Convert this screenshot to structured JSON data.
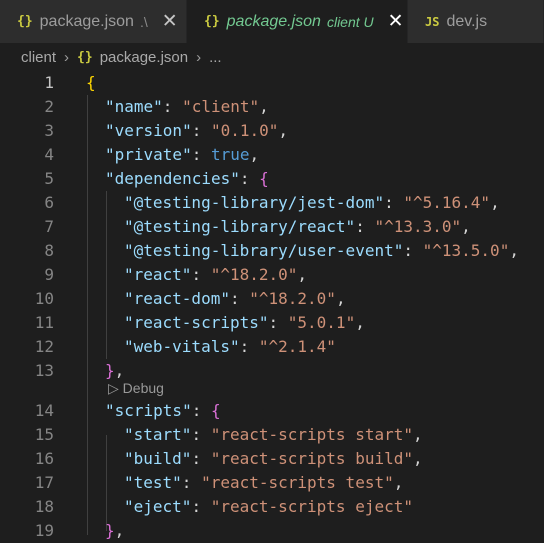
{
  "tabs": [
    {
      "icon": "{}",
      "name": "package.json",
      "hint": ".\\",
      "close": "✕"
    },
    {
      "icon": "{}",
      "name": "package.json",
      "hint": "client",
      "status": "U",
      "close": "✕"
    },
    {
      "icon": "JS",
      "name": "dev.js"
    }
  ],
  "breadcrumb": {
    "folder": "client",
    "file_icon": "{}",
    "file": "package.json",
    "more": "..."
  },
  "codelens": {
    "label": "Debug"
  },
  "lines": [
    {
      "n": "1",
      "t": [
        [
          "b1",
          "{"
        ]
      ]
    },
    {
      "n": "2",
      "t": [
        [
          "k",
          "\"name\""
        ],
        [
          "p",
          ": "
        ],
        [
          "s",
          "\"client\""
        ],
        [
          "p",
          ","
        ]
      ]
    },
    {
      "n": "3",
      "t": [
        [
          "k",
          "\"version\""
        ],
        [
          "p",
          ": "
        ],
        [
          "s",
          "\"0.1.0\""
        ],
        [
          "p",
          ","
        ]
      ]
    },
    {
      "n": "4",
      "t": [
        [
          "k",
          "\"private\""
        ],
        [
          "p",
          ": "
        ],
        [
          "lit",
          "true"
        ],
        [
          "p",
          ","
        ]
      ]
    },
    {
      "n": "5",
      "t": [
        [
          "k",
          "\"dependencies\""
        ],
        [
          "p",
          ": "
        ],
        [
          "b2",
          "{"
        ]
      ]
    },
    {
      "n": "6",
      "t": [
        [
          "k",
          "\"@testing-library/jest-dom\""
        ],
        [
          "p",
          ": "
        ],
        [
          "s",
          "\"^5.16.4\""
        ],
        [
          "p",
          ","
        ]
      ]
    },
    {
      "n": "7",
      "t": [
        [
          "k",
          "\"@testing-library/react\""
        ],
        [
          "p",
          ": "
        ],
        [
          "s",
          "\"^13.3.0\""
        ],
        [
          "p",
          ","
        ]
      ]
    },
    {
      "n": "8",
      "t": [
        [
          "k",
          "\"@testing-library/user-event\""
        ],
        [
          "p",
          ": "
        ],
        [
          "s",
          "\"^13.5.0\""
        ],
        [
          "p",
          ","
        ]
      ]
    },
    {
      "n": "9",
      "t": [
        [
          "k",
          "\"react\""
        ],
        [
          "p",
          ": "
        ],
        [
          "s",
          "\"^18.2.0\""
        ],
        [
          "p",
          ","
        ]
      ]
    },
    {
      "n": "10",
      "t": [
        [
          "k",
          "\"react-dom\""
        ],
        [
          "p",
          ": "
        ],
        [
          "s",
          "\"^18.2.0\""
        ],
        [
          "p",
          ","
        ]
      ]
    },
    {
      "n": "11",
      "t": [
        [
          "k",
          "\"react-scripts\""
        ],
        [
          "p",
          ": "
        ],
        [
          "s",
          "\"5.0.1\""
        ],
        [
          "p",
          ","
        ]
      ]
    },
    {
      "n": "12",
      "t": [
        [
          "k",
          "\"web-vitals\""
        ],
        [
          "p",
          ": "
        ],
        [
          "s",
          "\"^2.1.4\""
        ]
      ]
    },
    {
      "n": "13",
      "t": [
        [
          "b2",
          "}"
        ],
        [
          "p",
          ","
        ]
      ]
    },
    {
      "n": "14",
      "t": [
        [
          "k",
          "\"scripts\""
        ],
        [
          "p",
          ": "
        ],
        [
          "b2",
          "{"
        ]
      ]
    },
    {
      "n": "15",
      "t": [
        [
          "k",
          "\"start\""
        ],
        [
          "p",
          ": "
        ],
        [
          "s",
          "\"react-scripts start\""
        ],
        [
          "p",
          ","
        ]
      ]
    },
    {
      "n": "16",
      "t": [
        [
          "k",
          "\"build\""
        ],
        [
          "p",
          ": "
        ],
        [
          "s",
          "\"react-scripts build\""
        ],
        [
          "p",
          ","
        ]
      ]
    },
    {
      "n": "17",
      "t": [
        [
          "k",
          "\"test\""
        ],
        [
          "p",
          ": "
        ],
        [
          "s",
          "\"react-scripts test\""
        ],
        [
          "p",
          ","
        ]
      ]
    },
    {
      "n": "18",
      "t": [
        [
          "k",
          "\"eject\""
        ],
        [
          "p",
          ": "
        ],
        [
          "s",
          "\"react-scripts eject\""
        ]
      ]
    },
    {
      "n": "19",
      "t": [
        [
          "b2",
          "}"
        ],
        [
          "p",
          ","
        ]
      ]
    }
  ]
}
